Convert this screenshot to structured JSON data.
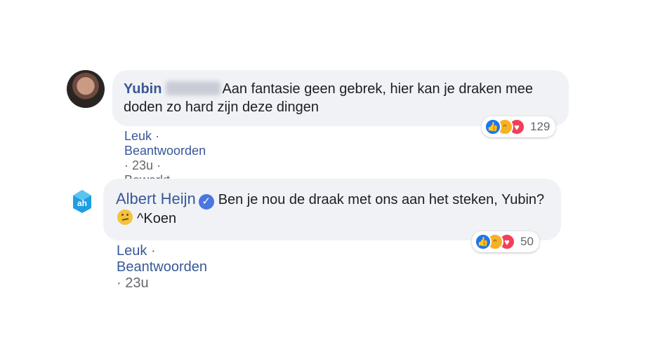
{
  "comments": [
    {
      "author": "Yubin",
      "text": "Aan fantasie geen gebrek, hier kan je draken mee doden zo hard zijn deze dingen",
      "actions": {
        "like": "Leuk",
        "reply": "Beantwoorden",
        "time": "23u",
        "edited": "Bewerkt",
        "separator": "·"
      },
      "reactions": {
        "count": "129",
        "icons": [
          "like-icon",
          "haha-icon",
          "love-icon"
        ]
      }
    },
    {
      "author": "Albert Heijn",
      "text_before_emoji": "Ben je nou de draak met ons aan het steken, Yubin?",
      "text_after_emoji": "^Koen",
      "actions": {
        "like": "Leuk",
        "reply": "Beantwoorden",
        "time": "23u",
        "separator": "·"
      },
      "reactions": {
        "count": "50",
        "icons": [
          "like-icon",
          "haha-icon",
          "love-icon"
        ]
      }
    }
  ],
  "colors": {
    "link": "#385898",
    "bubble": "#f0f2f5",
    "meta": "#65676b"
  }
}
